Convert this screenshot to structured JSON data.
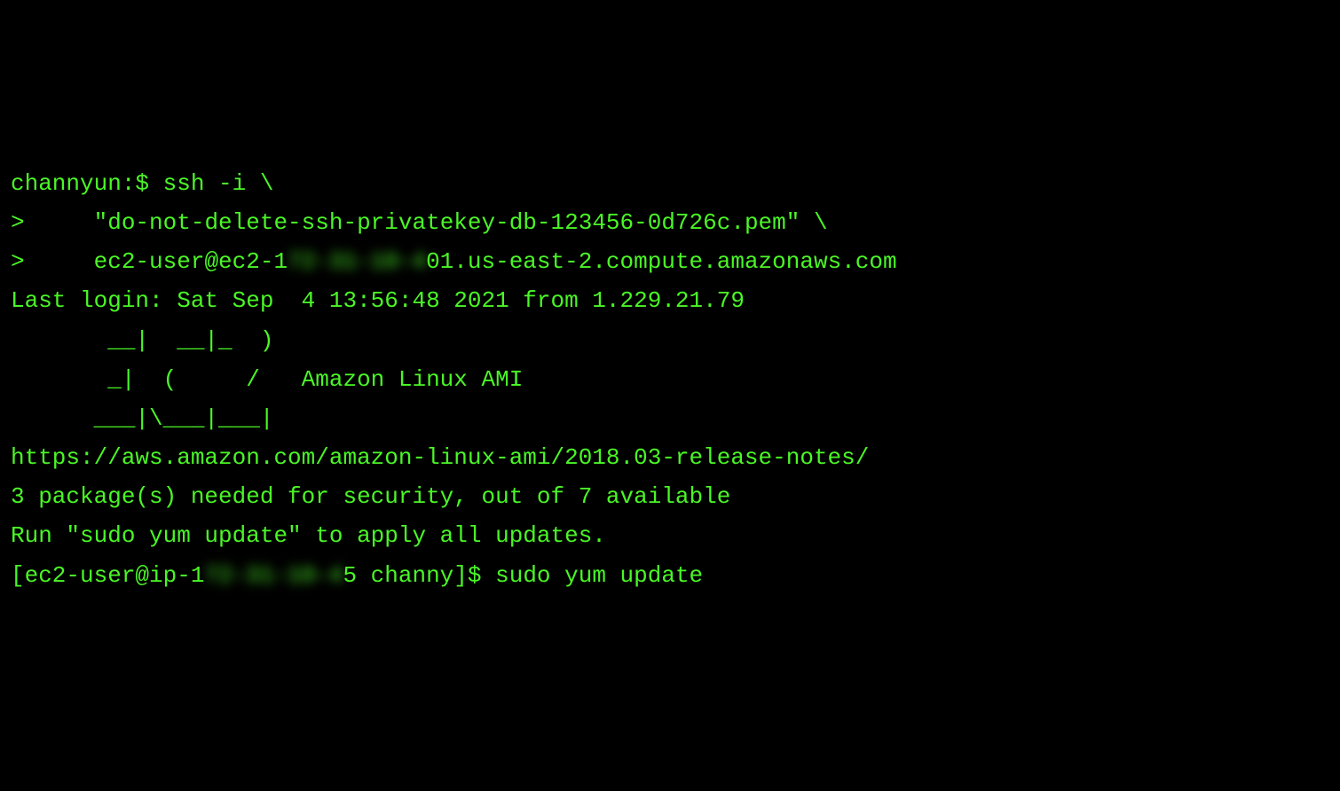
{
  "terminal": {
    "line1_prompt": "channyun:$ ",
    "line1_cmd": "ssh -i \\",
    "line2_prompt": ">     ",
    "line2_cmd": "\"do-not-delete-ssh-privatekey-db-123456-0d726c.pem\" \\",
    "line3_prompt": ">     ",
    "line3_pre": "ec2-user@ec2-1",
    "line3_blur": "72-31-10-4",
    "line3_post": "01.us-east-2.compute.amazonaws.com",
    "last_login": "Last login: Sat Sep  4 13:56:48 2021 from 1.229.21.79",
    "blank1": "",
    "ascii1": "       __|  __|_  )",
    "ascii2": "       _|  (     /   Amazon Linux AMI",
    "ascii3": "      ___|\\___|___|",
    "blank2": "",
    "url": "https://aws.amazon.com/amazon-linux-ami/2018.03-release-notes/",
    "security": "3 package(s) needed for security, out of 7 available",
    "runmsg": "Run \"sudo yum update\" to apply all updates.",
    "prompt2_pre": "[ec2-user@ip-1",
    "prompt2_blur": "72-31-10-4",
    "prompt2_post": "5 channy]$ ",
    "prompt2_cmd": "sudo yum update"
  }
}
